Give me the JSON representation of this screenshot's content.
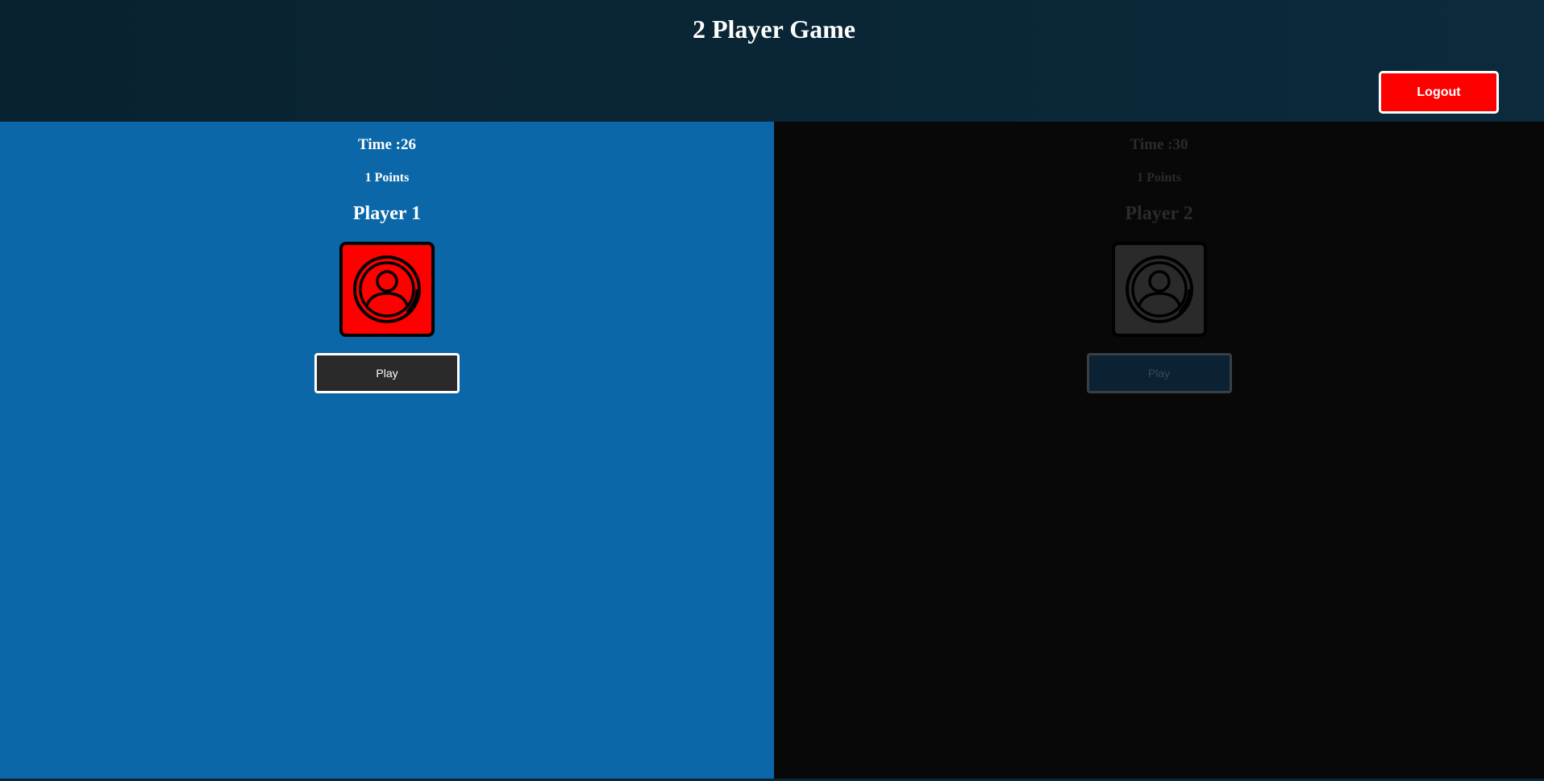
{
  "header": {
    "title": "2 Player Game",
    "logout_label": "Logout"
  },
  "players": [
    {
      "time": "Time :26",
      "points": "1 Points",
      "name": "Player 1",
      "play_label": "Play",
      "avatar_icon": "user-circle-icon",
      "state": "active"
    },
    {
      "time": "Time :30",
      "points": "1 Points",
      "name": "Player 2",
      "play_label": "Play",
      "avatar_icon": "user-circle-icon",
      "state": "inactive"
    }
  ],
  "colors": {
    "header_bg": "#0a2638",
    "active_panel": "#0b67a8",
    "inactive_panel": "#080808",
    "accent_red": "#ff0000"
  }
}
